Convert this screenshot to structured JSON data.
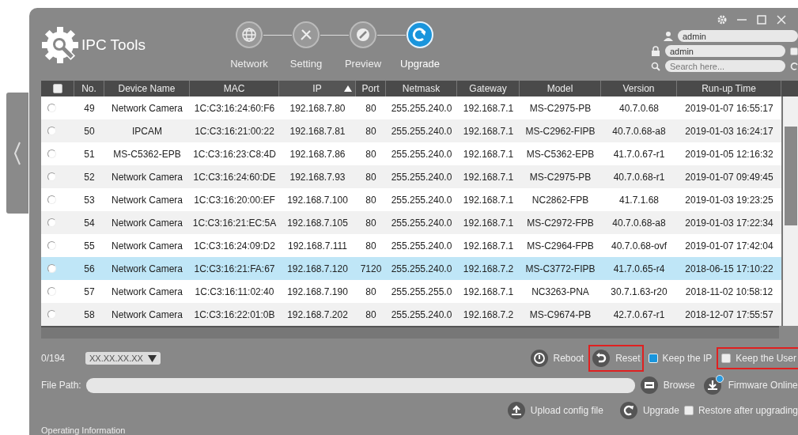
{
  "app": {
    "title": "IPC Tools"
  },
  "steps": [
    {
      "label": "Network",
      "selected": false,
      "kind": "globe"
    },
    {
      "label": "Setting",
      "selected": false,
      "kind": "tools"
    },
    {
      "label": "Preview",
      "selected": false,
      "kind": "preview"
    },
    {
      "label": "Upgrade",
      "selected": true,
      "kind": "upgrade"
    }
  ],
  "login": {
    "username": "admin",
    "password": "admin",
    "remember": false,
    "search_placeholder": "Search here..."
  },
  "table": {
    "all_checked": false,
    "columns": [
      {
        "label": "No.",
        "sorted": false
      },
      {
        "label": "Device Name",
        "sorted": false
      },
      {
        "label": "MAC",
        "sorted": false
      },
      {
        "label": "IP",
        "sorted": true
      },
      {
        "label": "Port",
        "sorted": false
      },
      {
        "label": "Netmask",
        "sorted": false
      },
      {
        "label": "Gateway",
        "sorted": false
      },
      {
        "label": "Model",
        "sorted": false
      },
      {
        "label": "Version",
        "sorted": false
      },
      {
        "label": "Run-up Time",
        "sorted": false
      }
    ],
    "rows": [
      {
        "checked": false,
        "selected": false,
        "cells": [
          "49",
          "Network Camera",
          "1C:C3:16:24:60:F6",
          "192.168.7.80",
          "80",
          "255.255.240.0",
          "192.168.7.1",
          "MS-C2975-PB",
          "40.7.0.68",
          "2019-01-07 16:55:17"
        ]
      },
      {
        "checked": false,
        "selected": false,
        "cells": [
          "50",
          "IPCAM",
          "1C:C3:16:21:00:22",
          "192.168.7.81",
          "80",
          "255.255.240.0",
          "192.168.7.1",
          "MS-C2962-FIPB",
          "40.7.0.68-a8",
          "2019-01-03 16:24:17"
        ]
      },
      {
        "checked": false,
        "selected": false,
        "cells": [
          "51",
          "MS-C5362-EPB",
          "1C:C3:16:23:C8:4D",
          "192.168.7.86",
          "80",
          "255.255.240.0",
          "192.168.7.1",
          "MS-C5362-EPB",
          "41.7.0.67-r1",
          "2019-01-05 12:16:32"
        ]
      },
      {
        "checked": false,
        "selected": false,
        "cells": [
          "52",
          "Network Camera",
          "1C:C3:16:24:60:DE",
          "192.168.7.93",
          "80",
          "255.255.240.0",
          "192.168.7.1",
          "MS-C2975-PB",
          "40.7.0.68-r1",
          "2019-01-07 09:49:45"
        ]
      },
      {
        "checked": false,
        "selected": false,
        "cells": [
          "53",
          "Network Camera",
          "1C:C3:16:20:00:EF",
          "192.168.7.100",
          "80",
          "255.255.240.0",
          "192.168.7.1",
          "NC2862-FPB",
          "41.7.1.68",
          "2019-01-03 19:23:25"
        ]
      },
      {
        "checked": false,
        "selected": false,
        "cells": [
          "54",
          "Network Camera",
          "1C:C3:16:21:EC:5A",
          "192.168.7.105",
          "80",
          "255.255.240.0",
          "192.168.7.1",
          "MS-C2972-FPB",
          "40.7.0.68-a8",
          "2019-01-03 17:22:34"
        ]
      },
      {
        "checked": false,
        "selected": false,
        "cells": [
          "55",
          "Network Camera",
          "1C:C3:16:24:09:D2",
          "192.168.7.111",
          "80",
          "255.255.240.0",
          "192.168.7.1",
          "MS-C2964-FPB",
          "40.7.0.68-ovf",
          "2019-01-07 17:42:04"
        ]
      },
      {
        "checked": false,
        "selected": true,
        "cells": [
          "56",
          "Network Camera",
          "1C:C3:16:21:FA:67",
          "192.168.7.120",
          "7120",
          "255.255.240.0",
          "192.168.7.2",
          "MS-C3772-FIPB",
          "41.7.0.65-r4",
          "2018-06-15 17:10:22"
        ]
      },
      {
        "checked": false,
        "selected": false,
        "cells": [
          "57",
          "Network Camera",
          "1C:C3:16:11:02:40",
          "192.168.7.190",
          "80",
          "255.255.255.0",
          "192.168.7.1",
          "NC3263-PNA",
          "30.7.1.63-r20",
          "2018-11-02 10:58:12"
        ]
      },
      {
        "checked": false,
        "selected": false,
        "cells": [
          "58",
          "Network Camera",
          "1C:C3:16:22:01:0B",
          "192.168.7.202",
          "80",
          "255.255.240.0",
          "192.168.7.2",
          "MS-C9674-PB",
          "42.7.0.67-r1",
          "2018-12-07 17:55:57"
        ]
      }
    ]
  },
  "count": "0/194",
  "ip_dropdown": "XX.XX.XX.XX",
  "file_path_label": "File Path:",
  "actions": {
    "reboot": "Reboot",
    "reset": "Reset",
    "keep_ip": {
      "label": "Keep the IP",
      "checked": true
    },
    "keep_user": {
      "label": "Keep the User",
      "checked": false
    },
    "browse": "Browse",
    "firmware_online": "Firmware Online",
    "upload_config": "Upload config file",
    "upgrade": "Upgrade",
    "restore": {
      "label": "Restore after upgrading",
      "checked": false
    }
  },
  "operating_info": "Operating Information"
}
